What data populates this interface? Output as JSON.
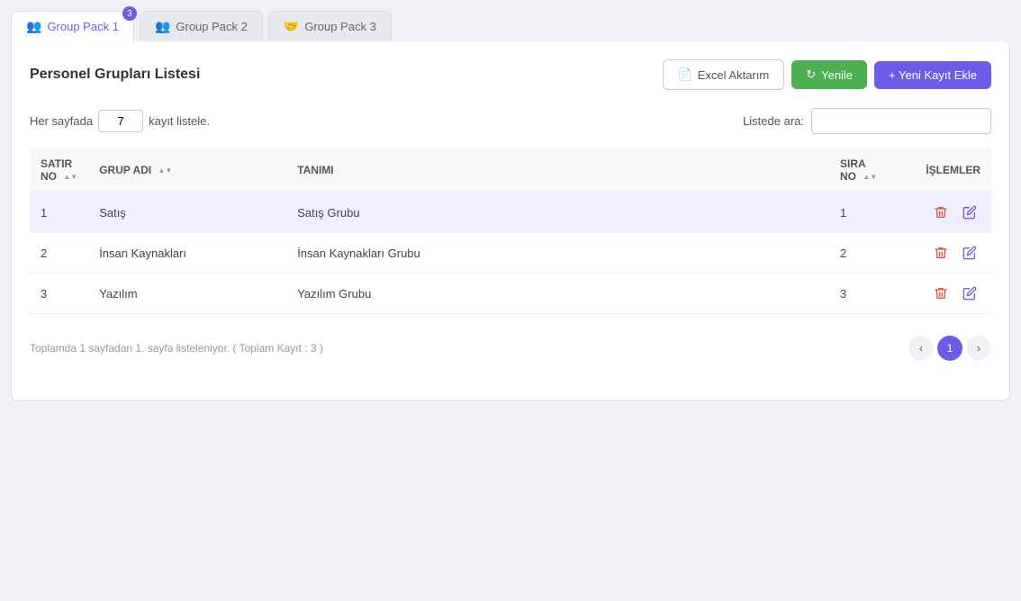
{
  "tabs": [
    {
      "id": "tab1",
      "label": "Group Pack 1",
      "icon": "👥",
      "active": true,
      "badge": 3
    },
    {
      "id": "tab2",
      "label": "Group Pack 2",
      "icon": "👥",
      "active": false,
      "badge": null
    },
    {
      "id": "tab3",
      "label": "Group Pack 3",
      "icon": "🤝",
      "active": false,
      "badge": null
    }
  ],
  "page_title": "Personel Grupları Listesi",
  "buttons": {
    "excel": "Excel Aktarım",
    "refresh": "Yenile",
    "add": "+ Yeni Kayıt Ekle"
  },
  "controls": {
    "per_page_label_before": "Her sayfada",
    "per_page_value": "7",
    "per_page_label_after": "kayıt listele.",
    "search_label": "Listede ara:",
    "search_placeholder": ""
  },
  "table": {
    "columns": [
      {
        "id": "satir_no",
        "label": "SATIR NO"
      },
      {
        "id": "grup_adi",
        "label": "GRUP ADI"
      },
      {
        "id": "tanim",
        "label": "TANIMI"
      },
      {
        "id": "sira_no",
        "label": "SIRA NO"
      },
      {
        "id": "islemler",
        "label": "İŞLEMLER"
      }
    ],
    "rows": [
      {
        "satir_no": 1,
        "grup_adi": "Satış",
        "tanim": "Satış Grubu",
        "sira_no": 1
      },
      {
        "satir_no": 2,
        "grup_adi": "İnsan Kaynakları",
        "tanim": "İnsan Kaynakları Grubu",
        "sira_no": 2
      },
      {
        "satir_no": 3,
        "grup_adi": "Yazılım",
        "tanim": "Yazılım Grubu",
        "sira_no": 3
      }
    ]
  },
  "footer": {
    "info": "Toplamda 1 sayfadan 1. sayfa listeleniyor. ( Toplam Kayıt : 3 )"
  },
  "pagination": {
    "prev_label": "‹",
    "next_label": "›",
    "current": 1,
    "pages": [
      1
    ]
  },
  "colors": {
    "active_tab": "#6c5ce7",
    "btn_add": "#6c5ce7",
    "btn_refresh": "#4CAF50",
    "delete_icon": "#e74c3c",
    "edit_icon": "#6c5ce7"
  }
}
